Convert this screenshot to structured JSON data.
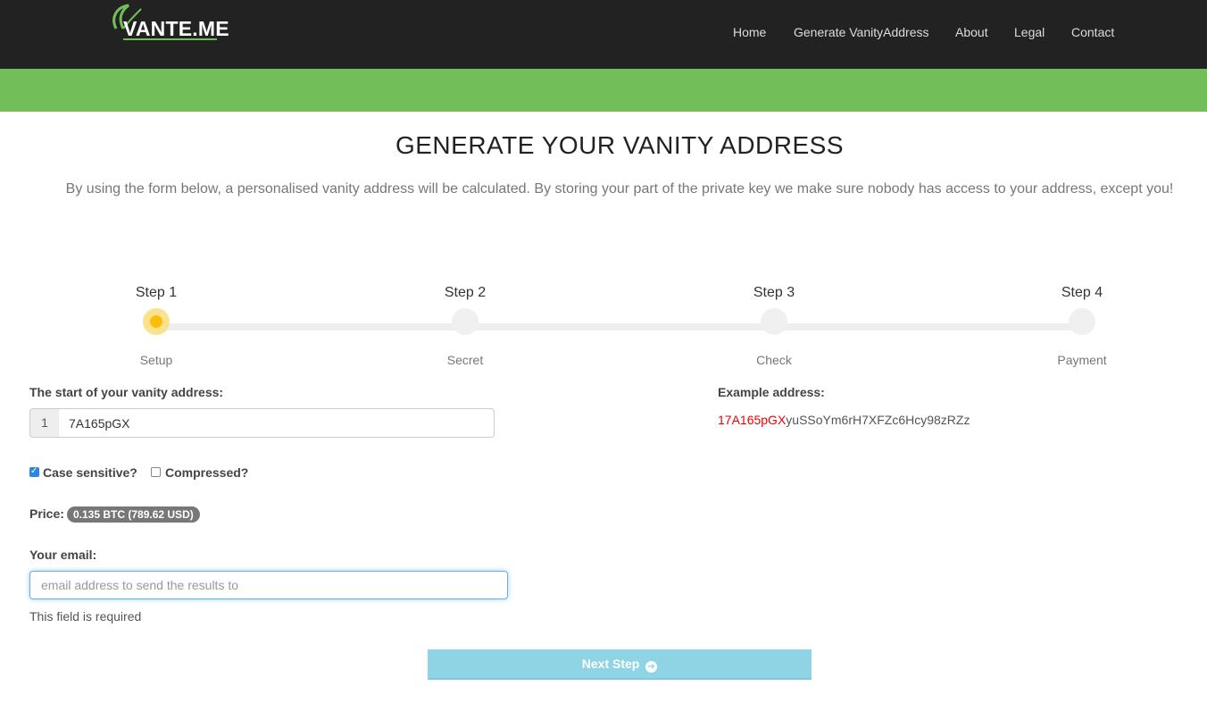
{
  "brand": {
    "name": "VANTE.ME",
    "accent": "#72bf5a"
  },
  "nav": {
    "items": [
      "Home",
      "Generate VanityAddress",
      "About",
      "Legal",
      "Contact"
    ]
  },
  "page": {
    "title": "GENERATE YOUR VANITY ADDRESS",
    "intro": "By using the form below, a personalised vanity address will be calculated. By storing your part of the private key we make sure nobody has access to your address, except you!"
  },
  "steps": [
    {
      "title": "Step 1",
      "label": "Setup",
      "active": true
    },
    {
      "title": "Step 2",
      "label": "Secret",
      "active": false
    },
    {
      "title": "Step 3",
      "label": "Check",
      "active": false
    },
    {
      "title": "Step 4",
      "label": "Payment",
      "active": false
    }
  ],
  "form": {
    "vanity_label": "The start of your vanity address:",
    "prefix": "1",
    "vanity_value": "7A165pGX",
    "example_label": "Example address:",
    "example_highlight": "17A165pGX",
    "example_rest": "yuSSoYm6rH7XFZc6Hcy98zRZz",
    "case_sensitive_label": "Case sensitive?",
    "case_sensitive_checked": true,
    "compressed_label": "Compressed?",
    "compressed_checked": false,
    "price_label": "Price:",
    "price_value": "0.135 BTC (789.62 USD)",
    "email_label": "Your email:",
    "email_placeholder": "email address to send the results to",
    "email_value": "",
    "error_text": "This field is required",
    "next_button": "Next Step"
  },
  "icons": {
    "next": "arrow-circle-right-icon",
    "checkbox": "checkbox-icon"
  }
}
